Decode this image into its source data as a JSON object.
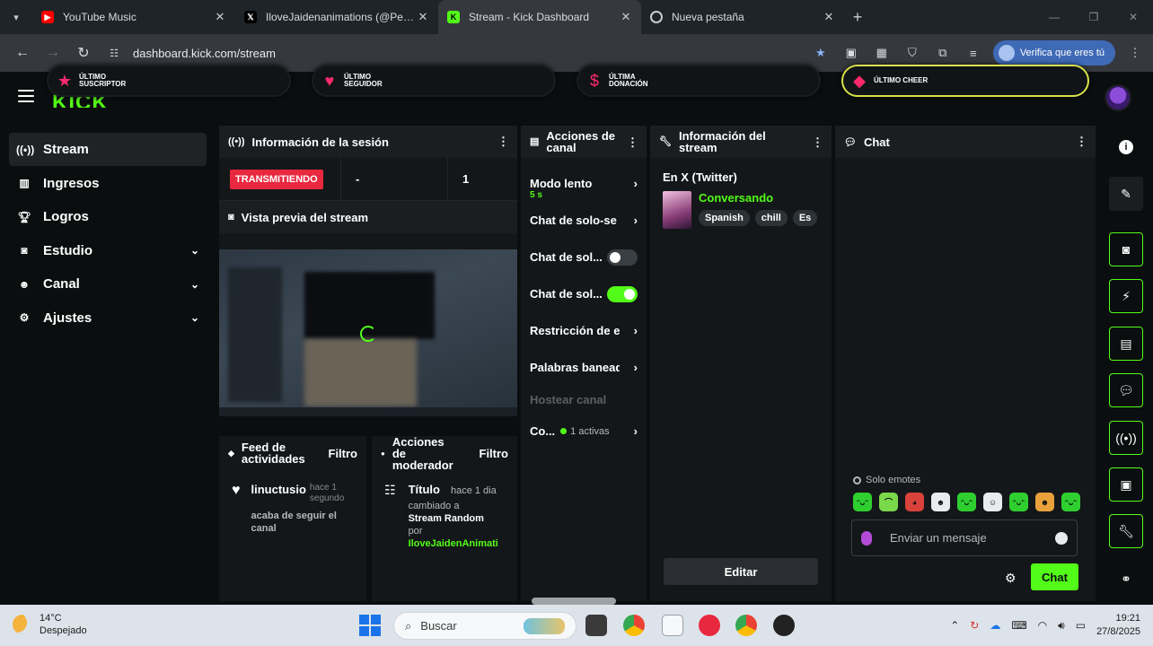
{
  "browser": {
    "tabs": [
      {
        "label": "YouTube Music",
        "favicon": "youtube-music-icon",
        "color": "#ff0000",
        "active": false
      },
      {
        "label": "IloveJaidenanimations (@Pereir",
        "favicon": "x-icon",
        "color": "#000000",
        "active": false
      },
      {
        "label": "Stream - Kick Dashboard",
        "favicon": "kick-icon",
        "color": "#53fc18",
        "active": true
      },
      {
        "label": "Nueva pestaña",
        "favicon": "chrome-icon",
        "color": "#9aa0a6",
        "active": false
      }
    ],
    "url": "dashboard.kick.com/stream",
    "profile_button": "Verifica que eres tú"
  },
  "overlay_alerts": [
    {
      "label": "ÚLTIMO SUSCRIPTOR",
      "icon": "star-icon"
    },
    {
      "label": "ÚLTIMO SEGUIDOR",
      "icon": "heart-icon"
    },
    {
      "label": "ÚLTIMA DONACIÓN",
      "icon": "dollar-icon"
    },
    {
      "label": "ÚLTIMO CHEER",
      "icon": "diamond-icon"
    }
  ],
  "brand": {
    "logo": "KICK",
    "accent": "#53fc18",
    "live_color": "#e8283f"
  },
  "sidebar": {
    "items": [
      {
        "label": "Stream",
        "icon": "broadcast-icon",
        "active": true,
        "expandable": false
      },
      {
        "label": "Ingresos",
        "icon": "chart-icon",
        "active": false,
        "expandable": false
      },
      {
        "label": "Logros",
        "icon": "trophy-icon",
        "active": false,
        "expandable": false
      },
      {
        "label": "Estudio",
        "icon": "camera-icon",
        "active": false,
        "expandable": true
      },
      {
        "label": "Canal",
        "icon": "users-icon",
        "active": false,
        "expandable": true
      },
      {
        "label": "Ajustes",
        "icon": "gear-icon",
        "active": false,
        "expandable": true
      }
    ]
  },
  "session": {
    "title": "Información de la sesión",
    "status": "TRANSMITIENDO",
    "duration": "-",
    "viewers": "1",
    "preview_title": "Vista previa del stream"
  },
  "feed": {
    "title": "Feed de actividades",
    "filter": "Filtro",
    "item": {
      "name": "linuctusio",
      "time": "hace 1 segundo",
      "desc": "acaba de seguir el canal"
    }
  },
  "mod_actions": {
    "title": "Acciones de moderador",
    "filter": "Filtro",
    "item": {
      "title": "Título",
      "time": "hace 1 dia",
      "desc_prefix": "cambiado a",
      "value": "Stream Random",
      "by": "por",
      "user": "IloveJaidenAnimati"
    }
  },
  "channel_actions": {
    "title": "Acciones de canal",
    "items": [
      {
        "label": "Modo lento",
        "sub": "5 s",
        "control": "chevron"
      },
      {
        "label": "Chat de solo-se",
        "control": "chevron"
      },
      {
        "label": "Chat de sol...",
        "control": "toggle",
        "on": false
      },
      {
        "label": "Chat de sol...",
        "control": "toggle",
        "on": true
      },
      {
        "label": "Restricción de e",
        "control": "chevron"
      },
      {
        "label": "Palabras baneadas",
        "control": "chevron"
      },
      {
        "label": "Hostear canal",
        "control": "none",
        "disabled": true
      },
      {
        "label": "Co...",
        "control": "chevron",
        "count": "1 activas"
      }
    ]
  },
  "stream_info": {
    "title": "Información del stream",
    "platform": "En X (Twitter)",
    "category": "Conversando",
    "tags": [
      "Spanish",
      "chill",
      "Es"
    ],
    "edit_button": "Editar"
  },
  "chat": {
    "title": "Chat",
    "mode_label": "Solo emotes",
    "placeholder": "Enviar un mensaje",
    "send_button": "Chat",
    "emotes": [
      "emote-1",
      "emote-2",
      "emote-3",
      "emote-4",
      "emote-5",
      "emote-6",
      "emote-7",
      "emote-8",
      "emote-9"
    ]
  },
  "taskbar": {
    "temperature": "14°C",
    "weather": "Despejado",
    "search_placeholder": "Buscar",
    "time": "19:21",
    "date": "27/8/2025"
  }
}
